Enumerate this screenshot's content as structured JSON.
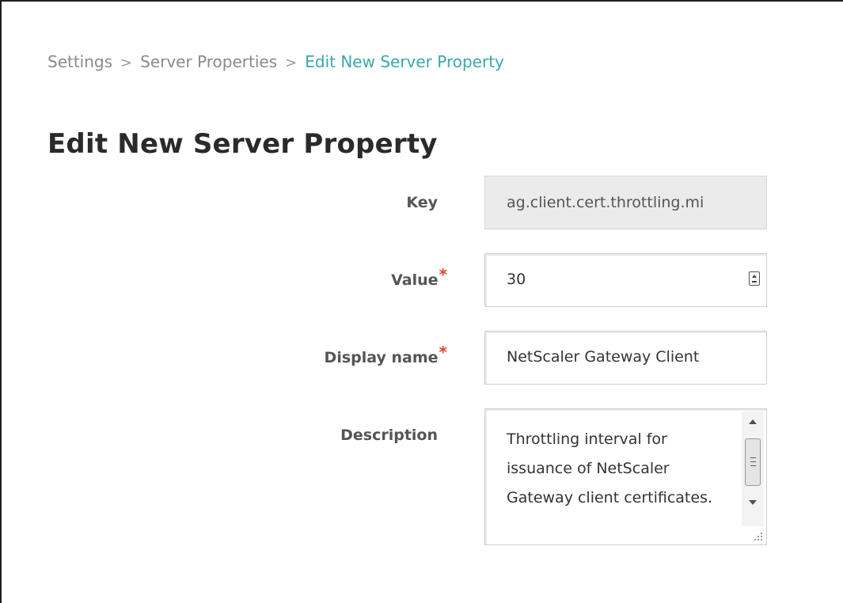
{
  "breadcrumb": {
    "items": [
      "Settings",
      "Server Properties",
      "Edit New Server Property"
    ],
    "separator": ">"
  },
  "page_title": "Edit New Server Property",
  "form": {
    "key": {
      "label": "Key",
      "value": "ag.client.cert.throttling.mi",
      "readonly": true
    },
    "value": {
      "label": "Value",
      "required_marker": "*",
      "value": "30",
      "icon": "stepper-icon"
    },
    "display_name": {
      "label": "Display name",
      "required_marker": "*",
      "value": "NetScaler Gateway Client"
    },
    "description": {
      "label": "Description",
      "value": "Throttling interval for issuance of NetScaler Gateway client certificates."
    }
  },
  "colors": {
    "breadcrumb_active": "#3ba8a8",
    "required_marker": "#e0442a",
    "readonly_field_bg": "#ebebeb"
  }
}
